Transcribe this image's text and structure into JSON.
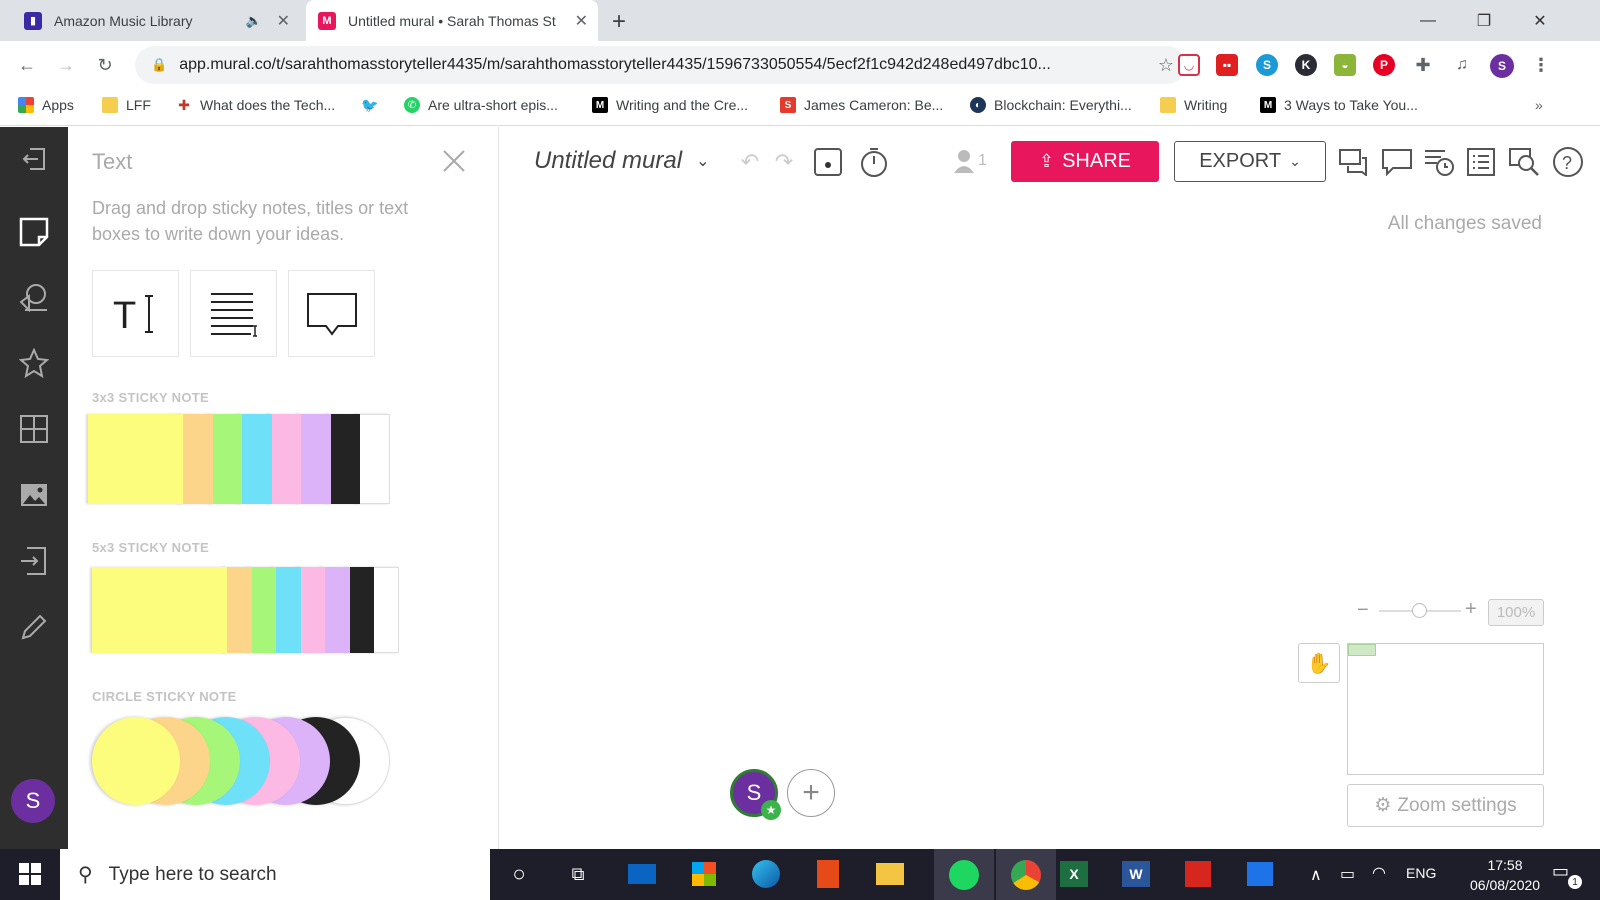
{
  "browser": {
    "tabs": [
      {
        "title": "Amazon Music Library",
        "active": false
      },
      {
        "title": "Untitled mural • Sarah Thomas St",
        "active": true
      }
    ],
    "url": "app.mural.co/t/sarahthomasstoryteller4435/m/sarahthomasstoryteller4435/1596733050554/5ecf2f1c942d248ed497dbc10...",
    "profile_initial": "S",
    "bookmarks": [
      {
        "label": "Apps",
        "icon": "apps-grid-icon"
      },
      {
        "label": "LFF",
        "icon": "folder-icon"
      },
      {
        "label": "What does the Tech...",
        "icon": "red-cross-icon"
      },
      {
        "label": "",
        "icon": "twitter-icon"
      },
      {
        "label": "Are ultra-short epis...",
        "icon": "whatsapp-icon"
      },
      {
        "label": "Writing and the Cre...",
        "icon": "medium-icon"
      },
      {
        "label": "James Cameron: Be...",
        "icon": "s-red-icon"
      },
      {
        "label": "Blockchain: Everythi...",
        "icon": "blockchain-icon"
      },
      {
        "label": "Writing",
        "icon": "folder-icon"
      },
      {
        "label": "3 Ways to Take You...",
        "icon": "medium-icon"
      }
    ],
    "more_bookmarks": "»"
  },
  "panel": {
    "title": "Text",
    "description": "Drag and drop sticky notes, titles or text boxes to write down your ideas.",
    "sections": [
      {
        "label": "3x3 STICKY NOTE"
      },
      {
        "label": "5x3 STICKY NOTE"
      },
      {
        "label": "CIRCLE STICKY NOTE"
      }
    ],
    "sticky_colors": [
      "#fdfd7d",
      "#fdd58a",
      "#a6f67a",
      "#6ee1f8",
      "#fcb9e4",
      "#dcb3f9",
      "#232323",
      "#ffffff"
    ]
  },
  "toolbar": {
    "mural_title": "Untitled mural",
    "collaborators_count": "1",
    "share_label": "SHARE",
    "export_label": "EXPORT",
    "status": "All changes saved",
    "share_color": "#e8175d"
  },
  "canvas": {
    "zoom_value": "100%",
    "zoom_minus": "−",
    "zoom_plus": "+",
    "zoom_settings_label": "Zoom settings",
    "user_initial": "S",
    "user_color": "#6b2fa0"
  },
  "rail": {
    "user_initial": "S"
  },
  "taskbar": {
    "search_placeholder": "Type here to search",
    "language": "ENG",
    "time": "17:58",
    "date": "06/08/2020",
    "notification_count": "1"
  }
}
